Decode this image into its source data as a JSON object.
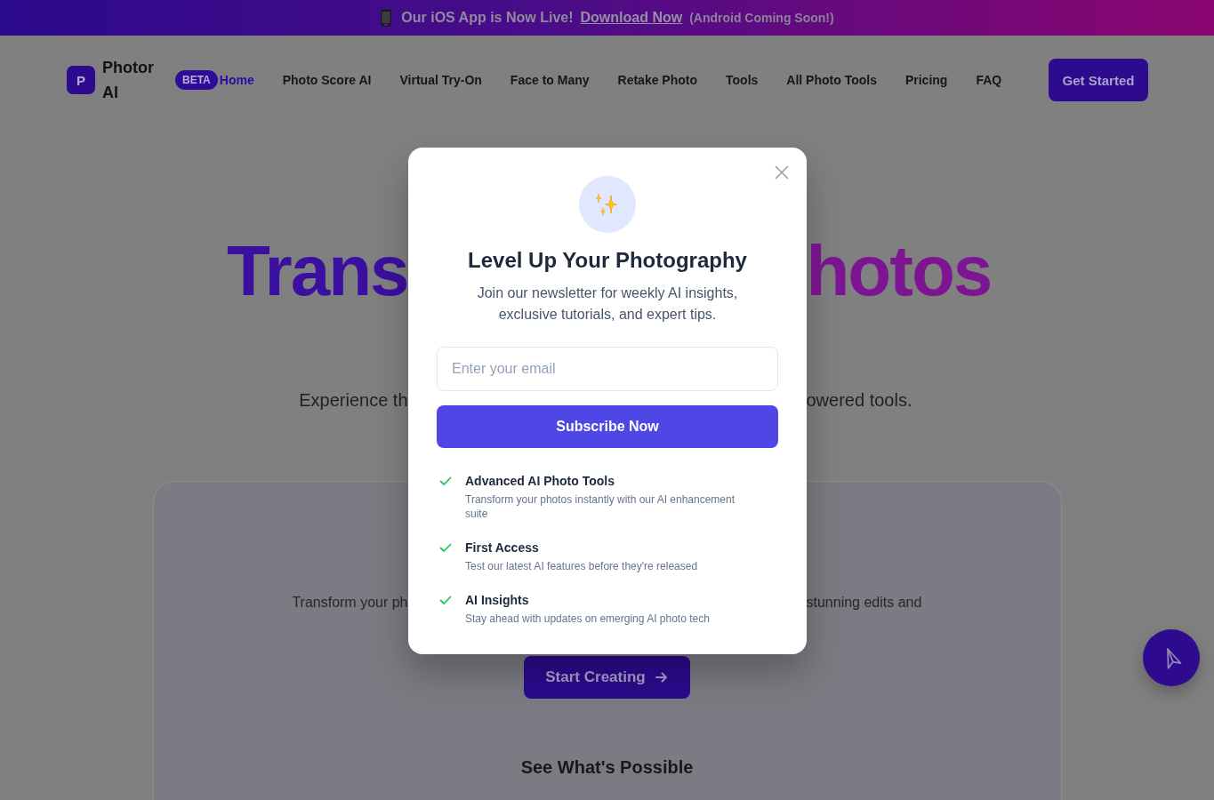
{
  "announcement_bar": {
    "message": "Our iOS App is Now Live!",
    "link": "Download Now",
    "note": "(Android Coming Soon!)"
  },
  "header": {
    "logo": {
      "mark": "P",
      "name": "Photor AI"
    },
    "badge": "BETA",
    "nav": [
      {
        "label": "Home",
        "selected": true
      },
      {
        "label": "Photo Score AI",
        "selected": false
      },
      {
        "label": "Virtual Try-On",
        "selected": false
      },
      {
        "label": "Face to Many",
        "selected": false
      },
      {
        "label": "Retake Photo",
        "selected": false
      },
      {
        "label": "Tools",
        "selected": false
      },
      {
        "label": "All Photo Tools",
        "selected": false
      },
      {
        "label": "Pricing",
        "selected": false
      },
      {
        "label": "FAQ",
        "selected": false
      }
    ],
    "cta": "Get Started"
  },
  "hero": {
    "title_lines": [
      {
        "left": "Trans",
        "right": "hotos"
      }
    ],
    "subtitle": {
      "left": "Experience th",
      "right": "owered tools."
    }
  },
  "card": {
    "text": {
      "left": "Transform your ph",
      "right": "stunning edits and"
    },
    "button": "Start Creating",
    "heading": "See What's Possible"
  },
  "modal": {
    "title": "Level Up Your Photography",
    "text": "Join our newsletter for weekly AI insights, exclusive tutorials, and expert tips.",
    "email": {
      "placeholder": "Enter your email"
    },
    "button": "Subscribe Now",
    "features": [
      {
        "title": "Advanced AI Photo Tools",
        "description": "Transform your photos instantly with our AI enhancement suite"
      },
      {
        "title": "First Access",
        "description": "Test our latest AI features before they're released"
      },
      {
        "title": "AI Insights",
        "description": "Stay ahead with updates on emerging AI photo tech"
      }
    ]
  }
}
